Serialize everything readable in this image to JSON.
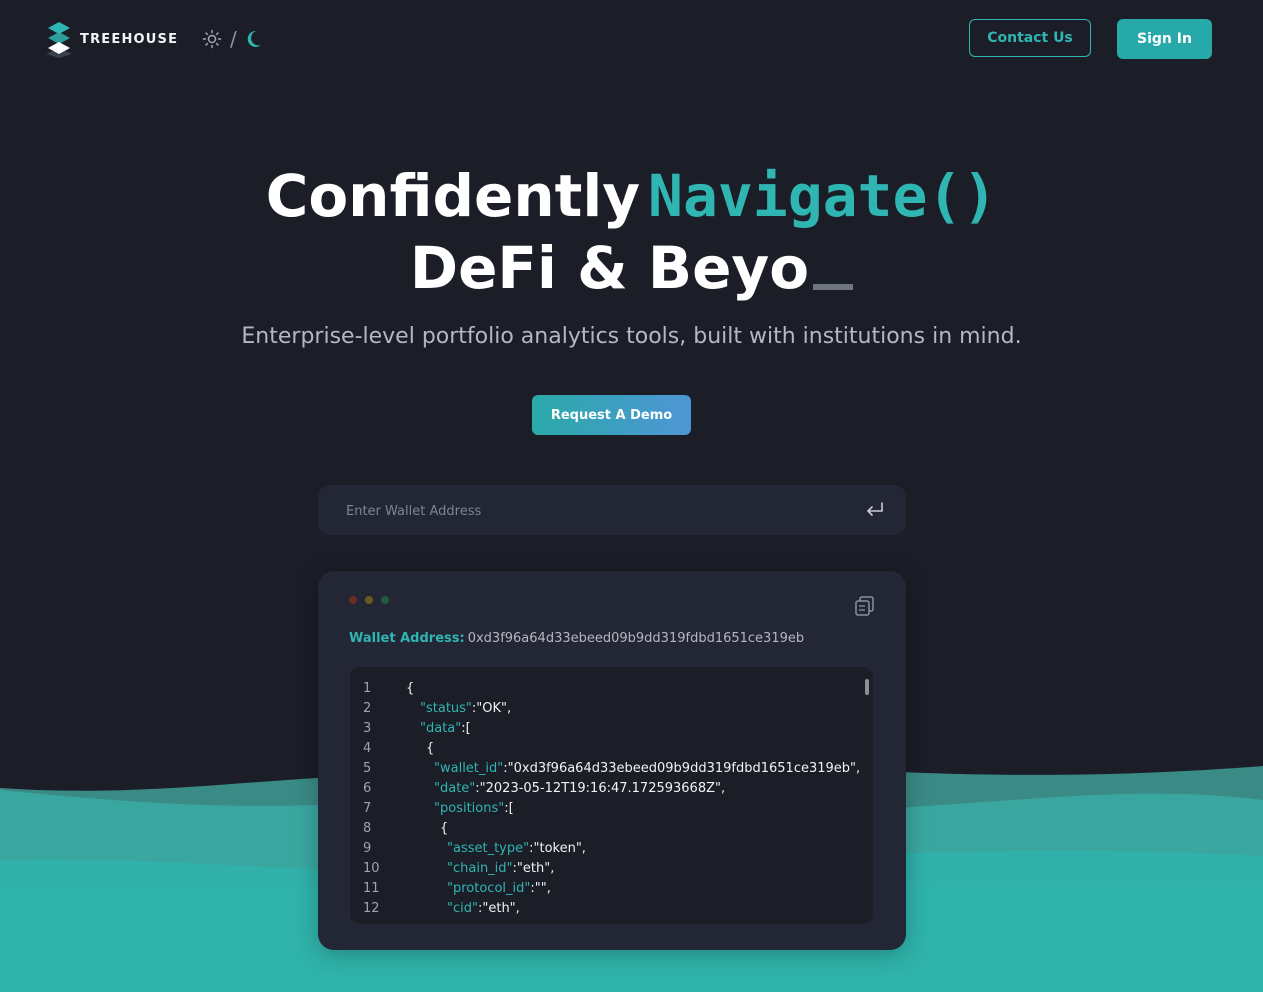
{
  "brand": {
    "name": "TREEHOUSE",
    "accent": "#2fb5b2"
  },
  "theme_toggle": {
    "light_icon": "sun-icon",
    "separator": "/",
    "dark_icon": "moon-icon"
  },
  "nav": {
    "contact_label": "Contact Us",
    "signin_label": "Sign In"
  },
  "hero": {
    "line1_text": "Confidently",
    "line1_code": "Navigate()",
    "line2_text": "DeFi & Beyo",
    "subtitle": "Enterprise-level portfolio analytics tools, built with institutions in mind.",
    "demo_label": "Request A Demo"
  },
  "wallet_input": {
    "placeholder": "Enter Wallet Address",
    "value": ""
  },
  "result": {
    "address_label": "Wallet Address:",
    "address_value": "0xd3f96a64d33ebeed09b9dd319fdbd1651ce319eb",
    "lines": [
      {
        "n": "1",
        "indent": 0,
        "key": "",
        "rest": "{"
      },
      {
        "n": "2",
        "indent": 1,
        "key": "\"status\"",
        "rest": ":\"OK\","
      },
      {
        "n": "3",
        "indent": 1,
        "key": "\"data\"",
        "rest": ":["
      },
      {
        "n": "4",
        "indent": 2,
        "key": "",
        "rest": "{"
      },
      {
        "n": "5",
        "indent": 3,
        "key": "\"wallet_id\"",
        "rest": ":\"0xd3f96a64d33ebeed09b9dd319fdbd1651ce319eb\","
      },
      {
        "n": "6",
        "indent": 3,
        "key": "\"date\"",
        "rest": ":\"2023-05-12T19:16:47.172593668Z\","
      },
      {
        "n": "7",
        "indent": 3,
        "key": "\"positions\"",
        "rest": ":["
      },
      {
        "n": "8",
        "indent": 4,
        "key": "",
        "rest": "{"
      },
      {
        "n": "9",
        "indent": 5,
        "key": "\"asset_type\"",
        "rest": ":\"token\","
      },
      {
        "n": "10",
        "indent": 5,
        "key": "\"chain_id\"",
        "rest": ":\"eth\","
      },
      {
        "n": "11",
        "indent": 5,
        "key": "\"protocol_id\"",
        "rest": ":\"\","
      },
      {
        "n": "12",
        "indent": 5,
        "key": "\"cid\"",
        "rest": ":\"eth\","
      }
    ]
  }
}
